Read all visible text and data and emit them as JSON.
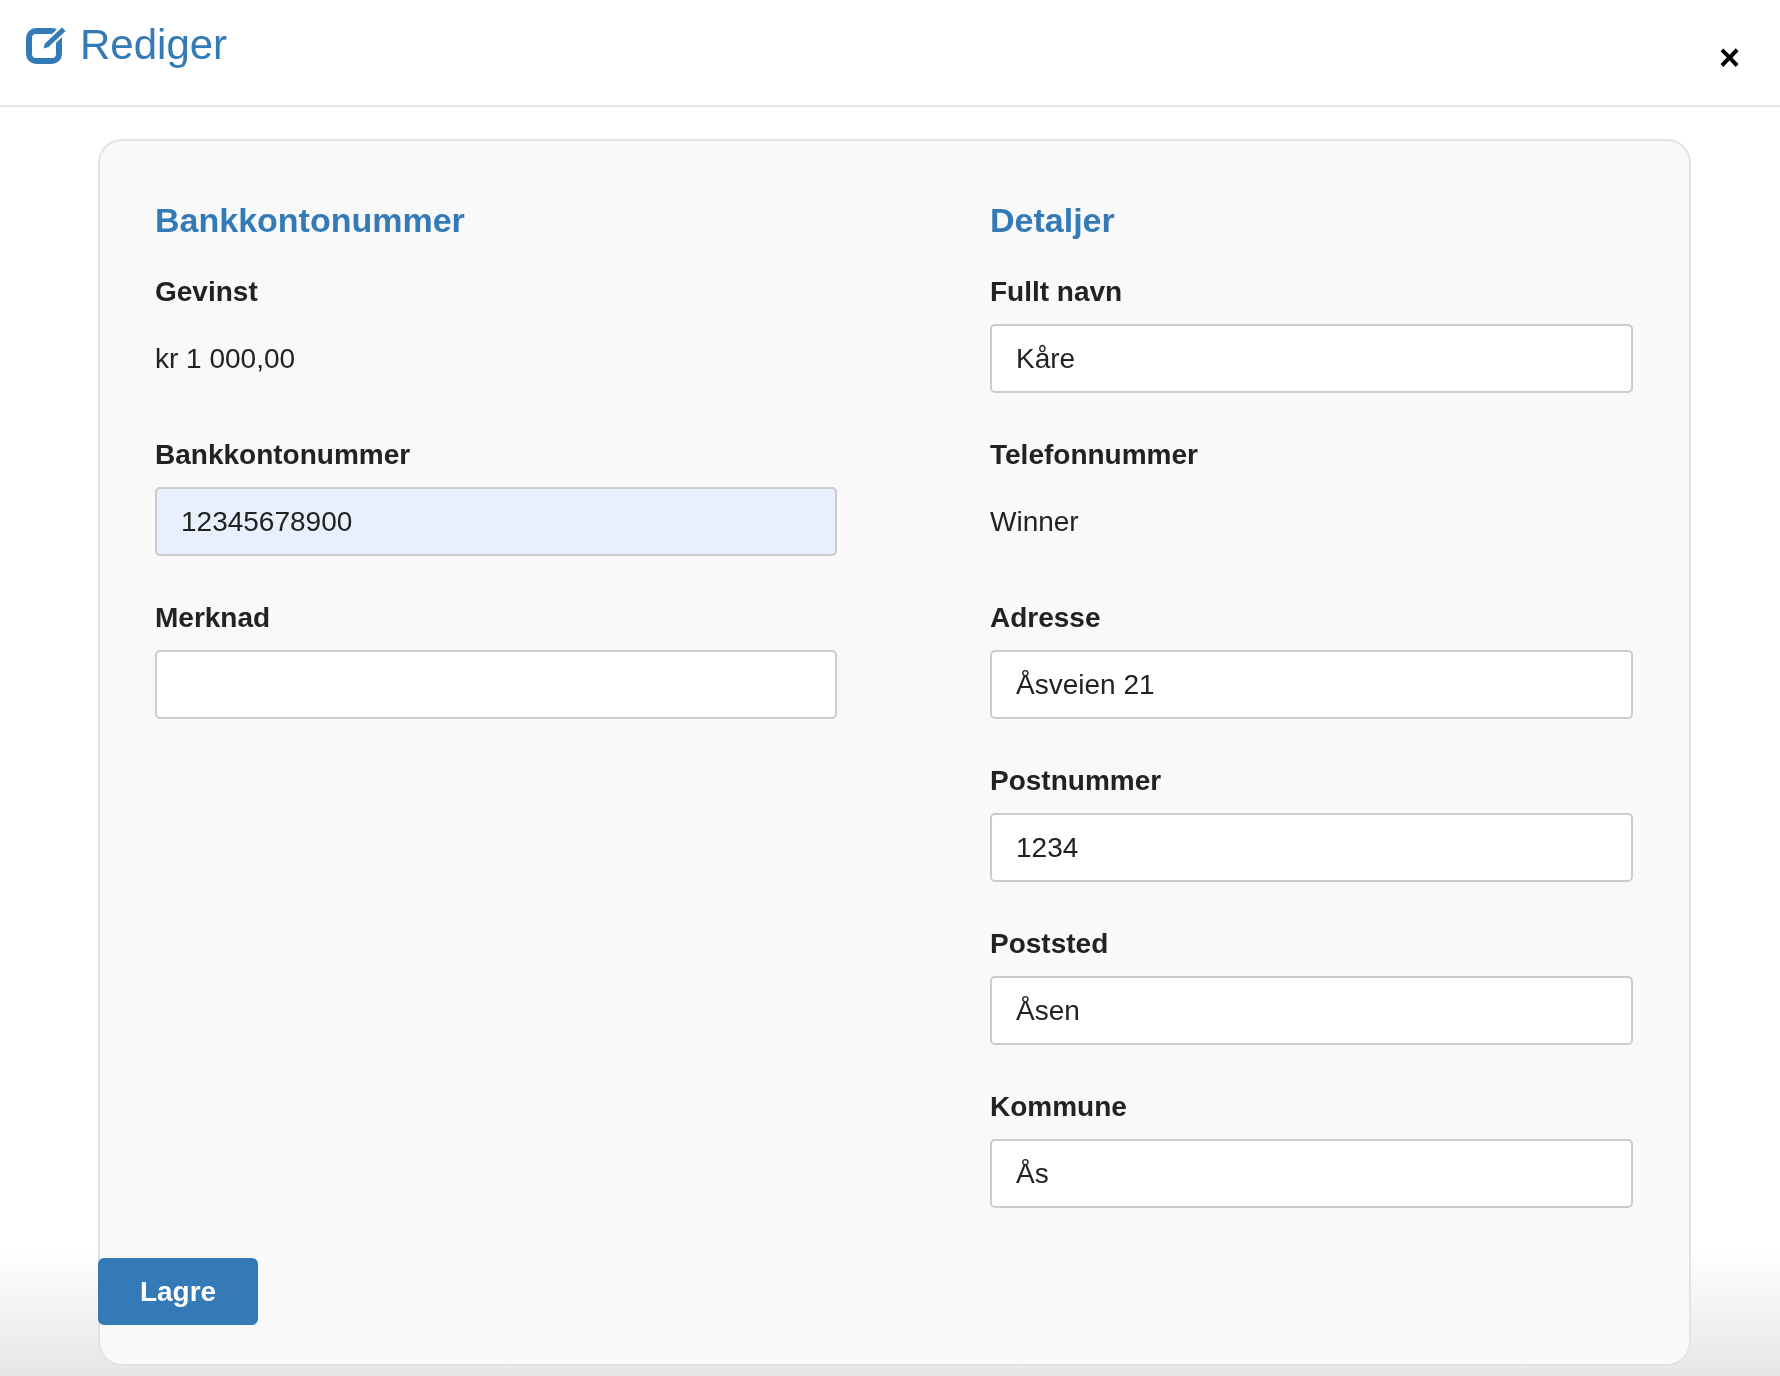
{
  "window": {
    "title": "Rediger",
    "close": "×"
  },
  "sections": [
    {
      "title": "Bankkontonummer",
      "fields": [
        {
          "kind": "text",
          "label": "Gevinst",
          "value": "kr 1 000,00"
        },
        {
          "kind": "input",
          "label": "Bankkontonummer",
          "value": "12345678900",
          "autofilled": true
        },
        {
          "kind": "input",
          "label": "Merknad",
          "autofilled": false
        }
      ]
    },
    {
      "title": "Detaljer",
      "fields": [
        {
          "kind": "input",
          "label": "Fullt navn",
          "value": "Kåre",
          "autofilled": false
        },
        {
          "kind": "text",
          "label": "Telefonnummer",
          "value": "Winner"
        },
        {
          "kind": "input",
          "label": "Adresse",
          "value": "Åsveien 21",
          "autofilled": false
        },
        {
          "kind": "input",
          "label": "Postnummer",
          "value": "1234",
          "autofilled": false
        },
        {
          "kind": "input",
          "label": "Poststed",
          "value": "Åsen",
          "autofilled": false
        },
        {
          "kind": "input",
          "label": "Kommune",
          "value": "Ås",
          "autofilled": false
        }
      ]
    }
  ],
  "save_button": "Lagre"
}
